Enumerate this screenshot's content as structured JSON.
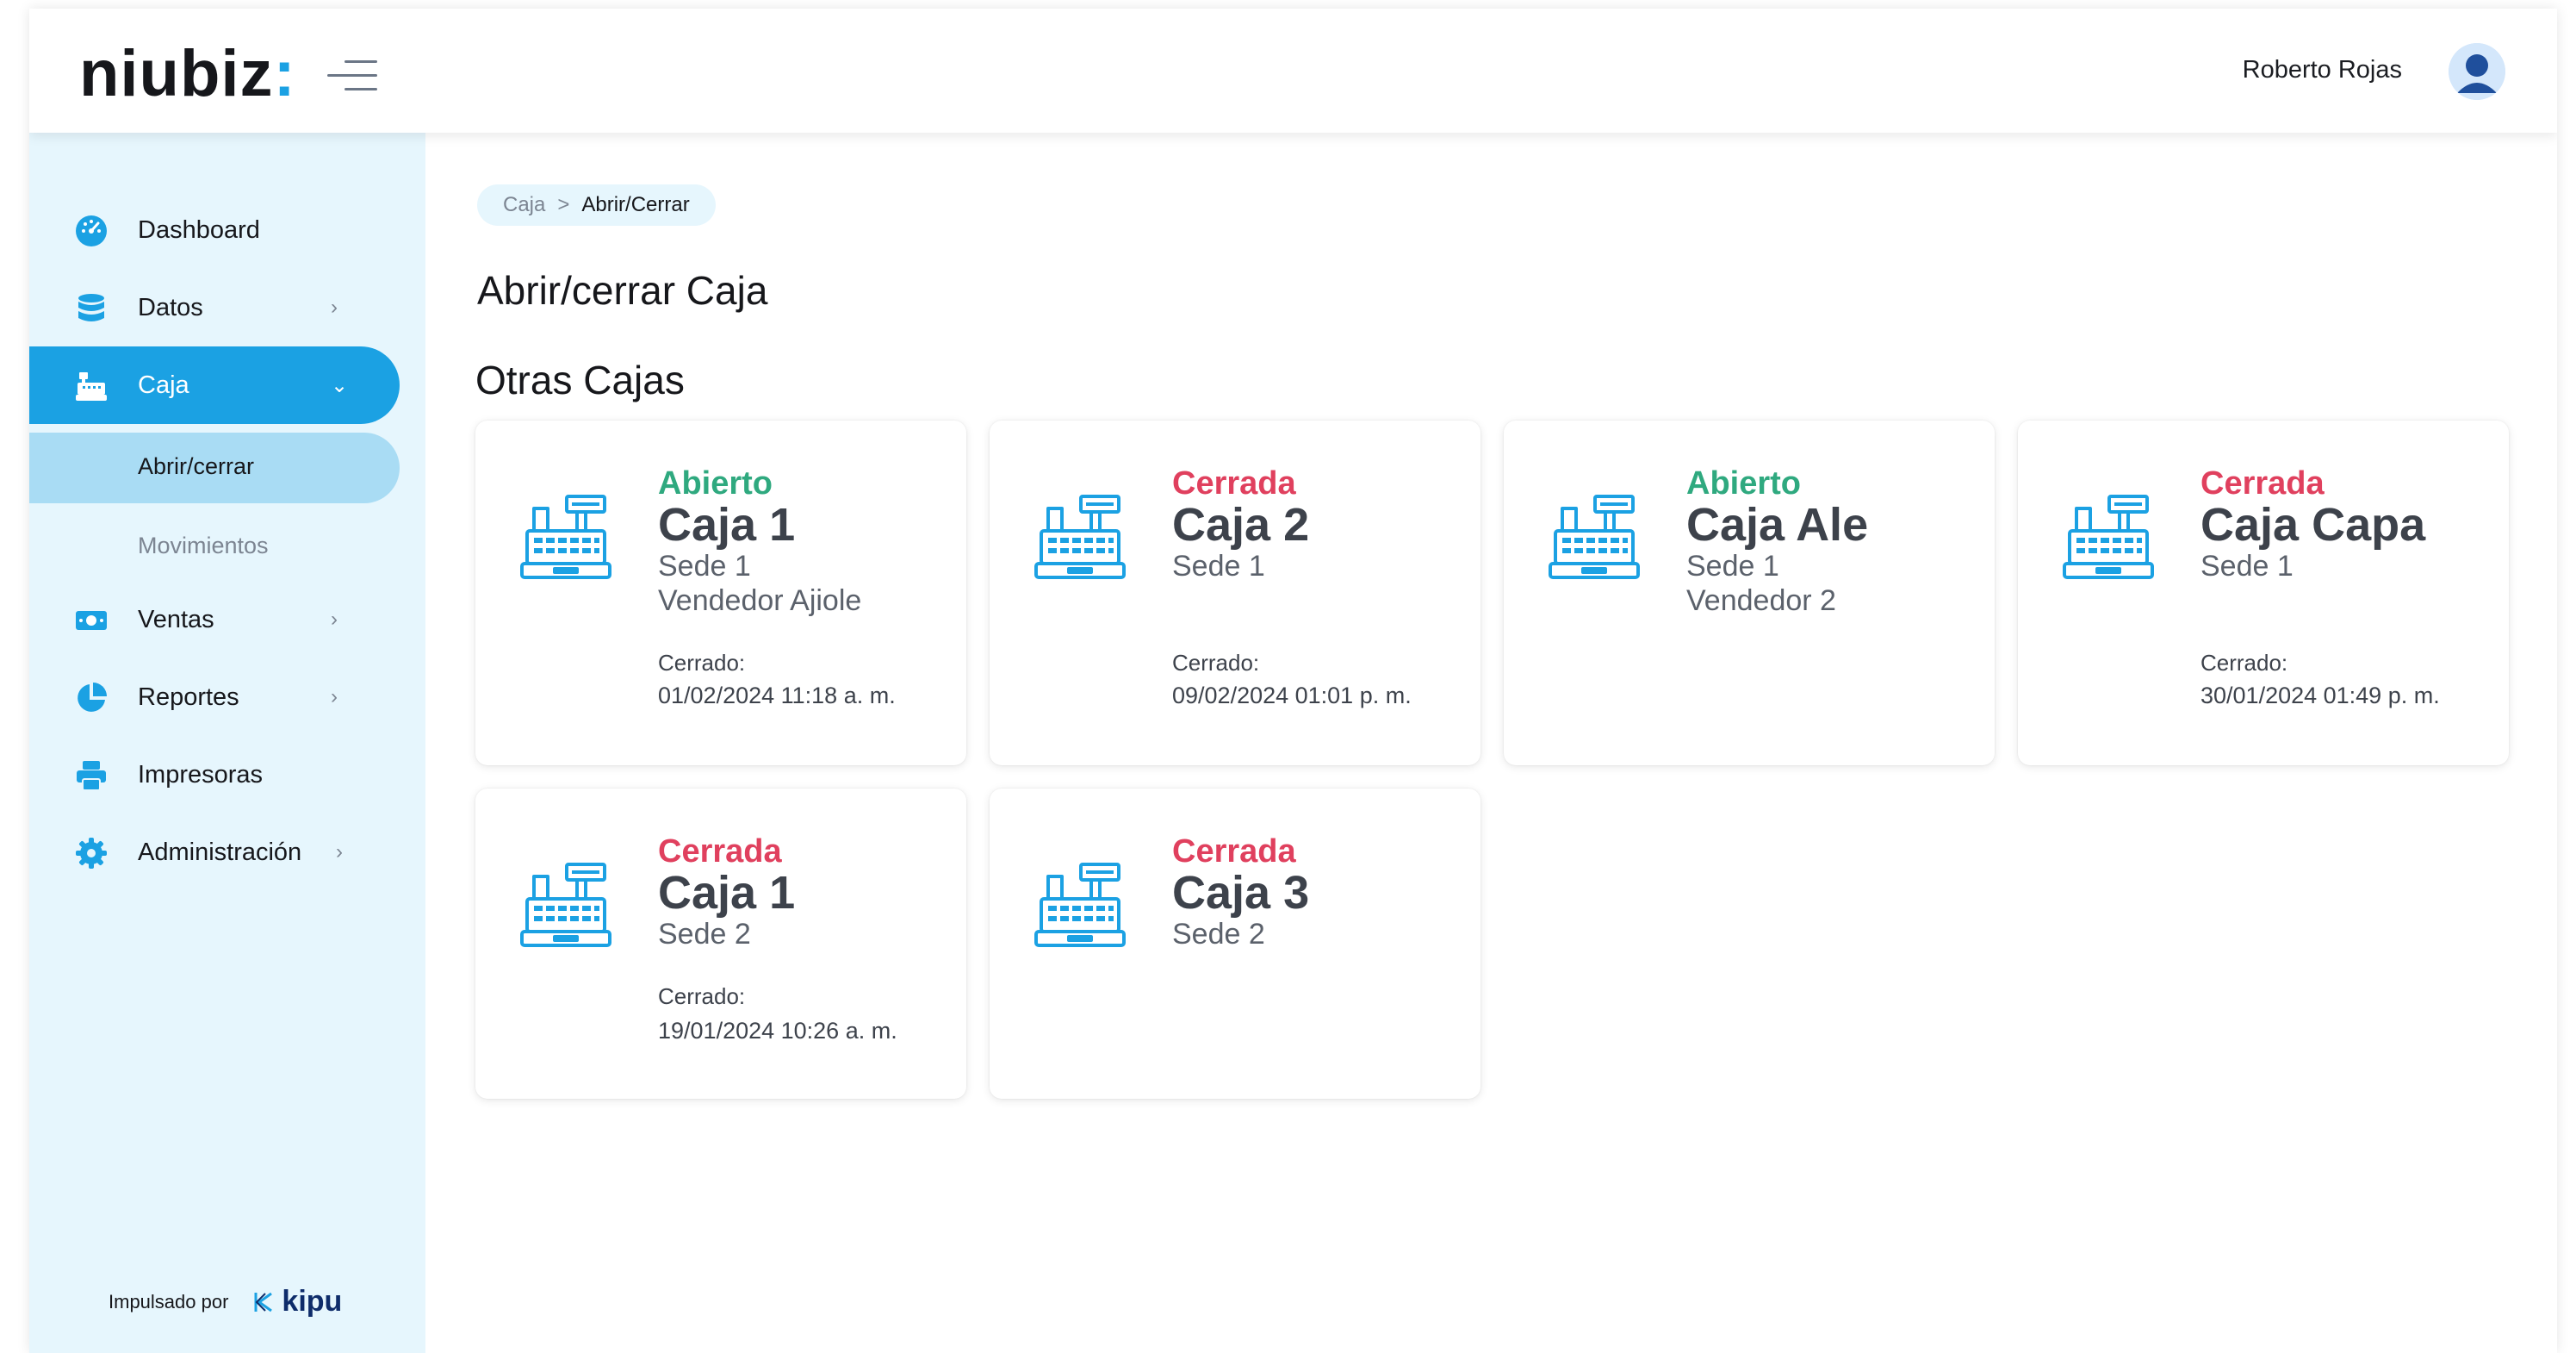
{
  "header": {
    "logo": "niubiz",
    "logo_colon": ":",
    "user_name": "Roberto Rojas"
  },
  "sidebar": {
    "items": [
      {
        "label": "Dashboard",
        "icon": "dashboard-icon",
        "has_chevron": false
      },
      {
        "label": "Datos",
        "icon": "database-icon",
        "has_chevron": true,
        "chevron": "›"
      },
      {
        "label": "Caja",
        "icon": "register-icon",
        "has_chevron": true,
        "chevron": "⌄",
        "active": true
      },
      {
        "label": "Ventas",
        "icon": "money-icon",
        "has_chevron": true,
        "chevron": "›"
      },
      {
        "label": "Reportes",
        "icon": "pie-chart-icon",
        "has_chevron": true,
        "chevron": "›"
      },
      {
        "label": "Impresoras",
        "icon": "printer-icon",
        "has_chevron": false
      },
      {
        "label": "Administración",
        "icon": "gear-icon",
        "has_chevron": true,
        "chevron": "›"
      }
    ],
    "subitems": [
      {
        "label": "Abrir/cerrar",
        "active": true
      },
      {
        "label": "Movimientos",
        "active": false
      }
    ],
    "powered_by": "Impulsado por",
    "brand": "kipu"
  },
  "breadcrumb": {
    "parent": "Caja",
    "separator": ">",
    "current": "Abrir/Cerrar"
  },
  "main": {
    "title": "Abrir/cerrar Caja",
    "section": "Otras Cajas"
  },
  "cards": [
    {
      "status": "Abierto",
      "status_type": "open",
      "name": "Caja 1",
      "sede": "Sede 1",
      "vendor": "Vendedor Ajiole",
      "closed_label": "Cerrado:",
      "closed_date": "01/02/2024 11:18 a. m."
    },
    {
      "status": "Cerrada",
      "status_type": "closed",
      "name": "Caja 2",
      "sede": "Sede 1",
      "vendor": "",
      "closed_label": "Cerrado:",
      "closed_date": "09/02/2024 01:01 p. m."
    },
    {
      "status": "Abierto",
      "status_type": "open",
      "name": "Caja Ale",
      "sede": "Sede 1",
      "vendor": "Vendedor 2",
      "closed_label": "",
      "closed_date": ""
    },
    {
      "status": "Cerrada",
      "status_type": "closed",
      "name": "Caja Capa",
      "sede": "Sede 1",
      "vendor": "",
      "closed_label": "Cerrado:",
      "closed_date": "30/01/2024 01:49 p. m."
    },
    {
      "status": "Cerrada",
      "status_type": "closed",
      "name": "Caja 1",
      "sede": "Sede 2",
      "vendor": "",
      "closed_label": "Cerrado:",
      "closed_date": "19/01/2024 10:26 a. m."
    },
    {
      "status": "Cerrada",
      "status_type": "closed",
      "name": "Caja 3",
      "sede": "Sede 2",
      "vendor": "",
      "closed_label": "",
      "closed_date": ""
    }
  ],
  "colors": {
    "accent": "#1ba1e3",
    "sidebar_bg": "#e6f6fd",
    "open": "#2fa97f",
    "closed": "#e0405e"
  }
}
